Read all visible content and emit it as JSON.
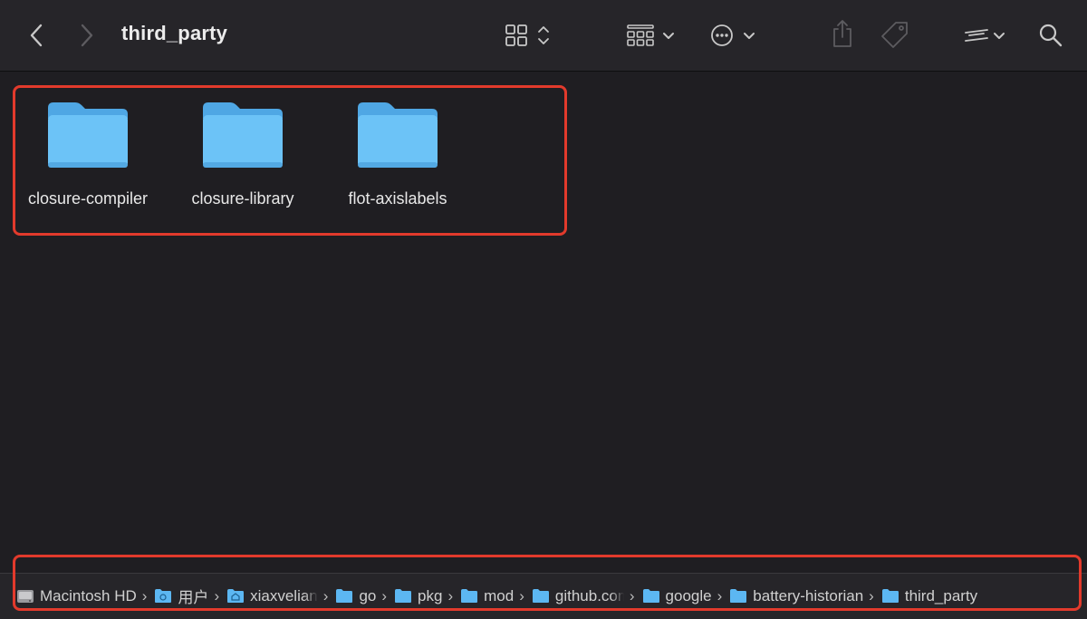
{
  "window": {
    "title": "third_party"
  },
  "toolbar": {
    "back_icon": "chevron-left-icon",
    "forward_icon": "chevron-right-icon",
    "view_icon": "grid-view-icon",
    "group_icon": "group-by-icon",
    "action_icon": "ellipsis-circle-icon",
    "share_icon": "share-icon",
    "tag_icon": "tag-icon",
    "more_icon": "double-chevron-icon",
    "search_icon": "search-icon"
  },
  "items": [
    {
      "name": "closure-compiler",
      "kind": "folder"
    },
    {
      "name": "closure-library",
      "kind": "folder"
    },
    {
      "name": "flot-axislabels",
      "kind": "folder"
    }
  ],
  "path_bar": [
    {
      "label": "Macintosh HD",
      "icon": "hard-drive-icon"
    },
    {
      "label": "用户",
      "icon": "folder-icon"
    },
    {
      "label": "xiaxvelian",
      "icon": "home-folder-icon"
    },
    {
      "label": "go",
      "icon": "folder-icon"
    },
    {
      "label": "pkg",
      "icon": "folder-icon"
    },
    {
      "label": "mod",
      "icon": "folder-icon"
    },
    {
      "label": "github.com",
      "icon": "folder-icon"
    },
    {
      "label": "google",
      "icon": "folder-icon"
    },
    {
      "label": "battery-historian",
      "icon": "folder-icon"
    },
    {
      "label": "third_party",
      "icon": "folder-icon"
    }
  ],
  "colors": {
    "background": "#1f1e22",
    "toolbar": "#262529",
    "folder_blue": "#6cc3f7",
    "highlight": "#e23a2c"
  }
}
